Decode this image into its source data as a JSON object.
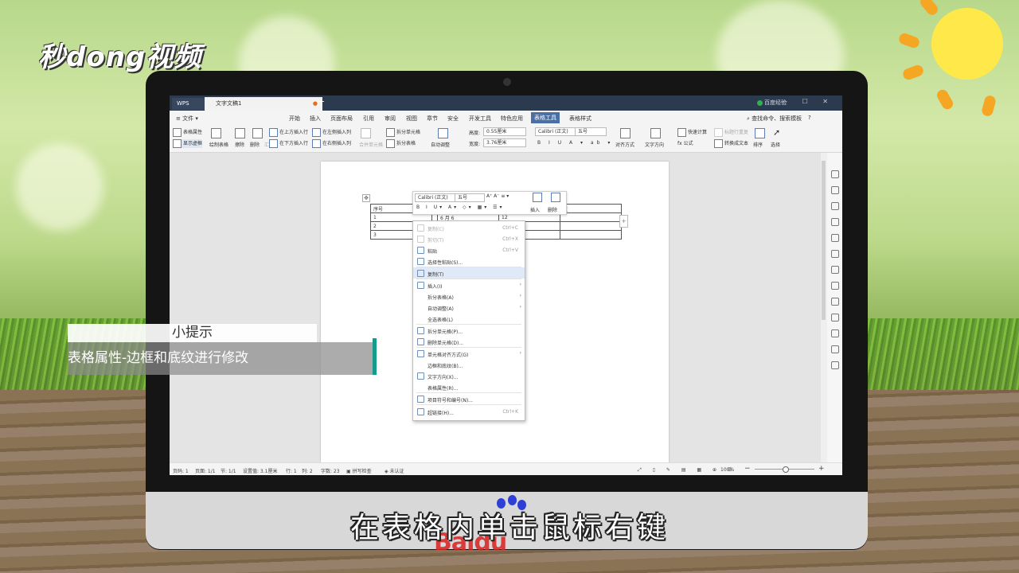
{
  "watermark": {
    "logo_text": "秒dong视频",
    "baidu_text": "Baidu"
  },
  "titlebar": {
    "app_tab": "WPS",
    "doc_tab": "文字文稿1",
    "new_tab": "+",
    "login": "百度经验",
    "window_controls": "—  ☐  ✕"
  },
  "menubar": {
    "file": "≡ 文件 ▾",
    "items": [
      "开始",
      "插入",
      "页面布局",
      "引用",
      "审阅",
      "视图",
      "章节",
      "安全",
      "开发工具",
      "特色应用",
      "表格工具",
      "表格样式"
    ],
    "active_index": 10,
    "search": "查找命令、搜索模板",
    "help": "?"
  },
  "ribbon": {
    "table_props": "表格属性",
    "show_gridlines": "显示虚框",
    "draw_table": "绘制表格",
    "erase": "擦除",
    "delete": "删除",
    "summary": "汇总",
    "insert_above": "在上方插入行",
    "insert_below": "在下方插入行",
    "insert_left": "在左侧插入列",
    "insert_right": "在右侧插入列",
    "merge_cells": "合并单元格",
    "split_cells": "拆分单元格",
    "split_table": "拆分表格",
    "autofit": "自动调整",
    "height_label": "高度:",
    "height_value": "0.55厘米",
    "width_label": "宽度:",
    "width_value": "3.76厘米",
    "font_name": "Calibri (正文)",
    "font_size": "五号",
    "align": "对齐方式",
    "text_dir": "文字方向",
    "quick_calc": "快速计算",
    "title_repeat": "标题行重复",
    "formula": "公式",
    "to_text": "转换成文本",
    "sort": "排序",
    "select": "选择"
  },
  "minitoolbar": {
    "font": "Calibri (正文)",
    "size": "五号",
    "insert": "插入",
    "delete": "删除"
  },
  "doc_table": {
    "rows": [
      [
        "序号",
        "",
        "",
        "",
        "注"
      ],
      [
        "1",
        "",
        "6 月 6",
        "12",
        ""
      ],
      [
        "2",
        "",
        "",
        "",
        ""
      ],
      [
        "3",
        "",
        "",
        "",
        ""
      ]
    ]
  },
  "context_menu": {
    "items": [
      {
        "label": "复制(C)",
        "shortcut": "Ctrl+C",
        "disabled": true
      },
      {
        "label": "剪切(T)",
        "shortcut": "Ctrl+X",
        "disabled": true
      },
      {
        "label": "粘贴",
        "shortcut": "Ctrl+V",
        "disabled": false
      },
      {
        "label": "选择性粘贴(S)...",
        "shortcut": "",
        "disabled": false
      },
      {
        "label": "复制(T)",
        "shortcut": "",
        "disabled": false,
        "highlight": true
      },
      {
        "label": "插入(I)",
        "shortcut": "",
        "submenu": true
      },
      {
        "label": "拆分表格(A)",
        "shortcut": "",
        "submenu": true
      },
      {
        "label": "自动调整(A)",
        "shortcut": "",
        "submenu": true
      },
      {
        "label": "全选表格(L)",
        "shortcut": ""
      },
      {
        "label": "拆分单元格(P)...",
        "shortcut": ""
      },
      {
        "label": "删除单元格(D)...",
        "shortcut": ""
      },
      {
        "label": "单元格对齐方式(G)",
        "shortcut": "",
        "submenu": true
      },
      {
        "label": "边框和底纹(B)...",
        "shortcut": ""
      },
      {
        "label": "文字方向(X)...",
        "shortcut": ""
      },
      {
        "label": "表格属性(R)...",
        "shortcut": ""
      },
      {
        "label": "项目符号和编号(N)...",
        "shortcut": ""
      },
      {
        "label": "超链接(H)...",
        "shortcut": "Ctrl+K"
      }
    ]
  },
  "statusbar": {
    "page": "页码: 1",
    "pages": "页面: 1/1",
    "section": "节: 1/1",
    "setting": "设置值: 3.1厘米",
    "row": "行: 1",
    "col": "列: 2",
    "chars": "字数: 23",
    "spellcheck": "拼写检查",
    "cert": "未认证",
    "zoom": "100%",
    "minus": "−",
    "plus": "+"
  },
  "tip": {
    "title": "小提示",
    "body": "表格属性-边框和底纹进行修改"
  },
  "subtitle": "在表格内单击鼠标右键"
}
